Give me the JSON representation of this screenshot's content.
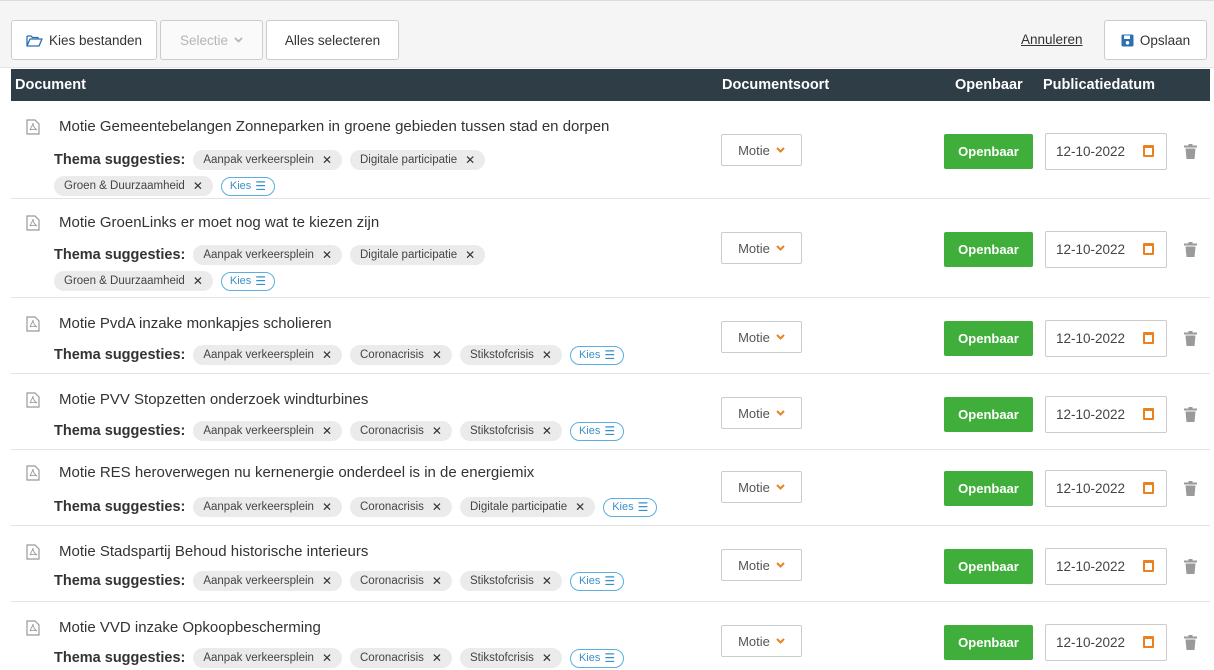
{
  "toolbar": {
    "choose_files": "Kies bestanden",
    "selection": "Selectie",
    "select_all": "Alles selecteren",
    "cancel": "Annuleren",
    "save": "Opslaan"
  },
  "table": {
    "headers": {
      "document": "Document",
      "doc_type": "Documentsoort",
      "public": "Openbaar",
      "pub_date": "Publicatiedatum"
    },
    "theme_label": "Thema suggesties:",
    "choose_label": "Kies",
    "rows": [
      {
        "title": "Motie Gemeentebelangen Zonneparken in groene gebieden tussen stad en dorpen",
        "tags": [
          "Aanpak verkeersplein",
          "Digitale participatie",
          "Groen & Duurzaamheid"
        ],
        "doc_type": "Motie",
        "public": "Openbaar",
        "date": "12-10-2022"
      },
      {
        "title": "Motie GroenLinks er moet nog wat te kiezen zijn",
        "tags": [
          "Aanpak verkeersplein",
          "Digitale participatie",
          "Groen & Duurzaamheid"
        ],
        "doc_type": "Motie",
        "public": "Openbaar",
        "date": "12-10-2022"
      },
      {
        "title": "Motie PvdA inzake monkapjes scholieren",
        "tags": [
          "Aanpak verkeersplein",
          "Coronacrisis",
          "Stikstofcrisis"
        ],
        "doc_type": "Motie",
        "public": "Openbaar",
        "date": "12-10-2022"
      },
      {
        "title": "Motie PVV Stopzetten onderzoek windturbines",
        "tags": [
          "Aanpak verkeersplein",
          "Coronacrisis",
          "Stikstofcrisis"
        ],
        "doc_type": "Motie",
        "public": "Openbaar",
        "date": "12-10-2022"
      },
      {
        "title": "Motie RES heroverwegen nu kernenergie onderdeel is in de energiemix",
        "tags": [
          "Aanpak verkeersplein",
          "Coronacrisis",
          "Digitale participatie"
        ],
        "doc_type": "Motie",
        "public": "Openbaar",
        "date": "12-10-2022"
      },
      {
        "title": "Motie Stadspartij Behoud historische interieurs",
        "tags": [
          "Aanpak verkeersplein",
          "Coronacrisis",
          "Stikstofcrisis"
        ],
        "doc_type": "Motie",
        "public": "Openbaar",
        "date": "12-10-2022"
      },
      {
        "title": "Motie VVD inzake Opkoopbescherming",
        "tags": [
          "Aanpak verkeersplein",
          "Coronacrisis",
          "Stikstofcrisis"
        ],
        "doc_type": "Motie",
        "public": "Openbaar",
        "date": "12-10-2022"
      }
    ]
  },
  "colors": {
    "header_bg": "#2f3d47",
    "public_green": "#3fae3a",
    "accent_orange": "#e8821f",
    "link_blue": "#3a8fc8"
  }
}
